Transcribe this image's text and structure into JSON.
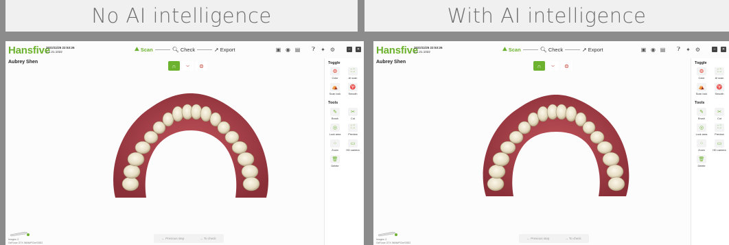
{
  "banners": {
    "left": "No AI intelligence",
    "right": "With AI intelligence"
  },
  "app": {
    "logo": "Hansfive",
    "datetime": "2021/11/25 22:53:26",
    "version": "1.1.21.1022",
    "patient": "Aubrey Shen",
    "steps": [
      {
        "label": "Scan",
        "icon": "scan-icon",
        "active": true
      },
      {
        "label": "Check",
        "icon": "magnifier-icon",
        "active": false
      },
      {
        "label": "Export",
        "icon": "export-icon",
        "active": false
      }
    ],
    "toolbar_icons": [
      "folder-icon",
      "record-icon",
      "screenshot-icon",
      "help-icon",
      "magic-icon",
      "settings-icon",
      "minimize-icon",
      "close-icon"
    ],
    "accent_color": "#6cb22e",
    "toggle_title": "Toggle",
    "toggle_items": [
      {
        "label": "Color",
        "icon": "color-wheel-icon"
      },
      {
        "label": "AI scan",
        "icon": "ai-scan-icon"
      },
      {
        "label": "Scan lock",
        "icon": "scan-lock-icon"
      },
      {
        "label": "Smooth",
        "icon": "smooth-icon"
      }
    ],
    "tools_title": "Tools",
    "tools_items": [
      {
        "label": "Brush",
        "icon": "brush-icon"
      },
      {
        "label": "Cut",
        "icon": "cut-icon"
      },
      {
        "label": "Lock area",
        "icon": "lock-area-icon"
      },
      {
        "label": "Preview",
        "icon": "preview-icon"
      },
      {
        "label": "Zoom",
        "icon": "zoom-icon"
      },
      {
        "label": "HD camera",
        "icon": "hd-camera-icon"
      },
      {
        "label": "Delete",
        "icon": "delete-icon"
      }
    ],
    "status_line1": "Images: 0",
    "status_line2": "GeForce GTX 960M/PCIe/SSE2",
    "nav_prev": "← Previous step",
    "nav_next": "→ To check"
  },
  "panel2_app": {
    "toggle_items": [
      {
        "label": "Color"
      },
      {
        "label": "AI scan"
      },
      {
        "label": "Scan lock"
      },
      {
        "label": "Smooth"
      }
    ],
    "tools_items": [
      {
        "label": "Brush"
      },
      {
        "label": "Cut"
      },
      {
        "label": "Lock area"
      },
      {
        "label": "Preview"
      },
      {
        "label": "Zoom"
      },
      {
        "label": "HD camera"
      },
      {
        "label": "Delete"
      }
    ]
  }
}
